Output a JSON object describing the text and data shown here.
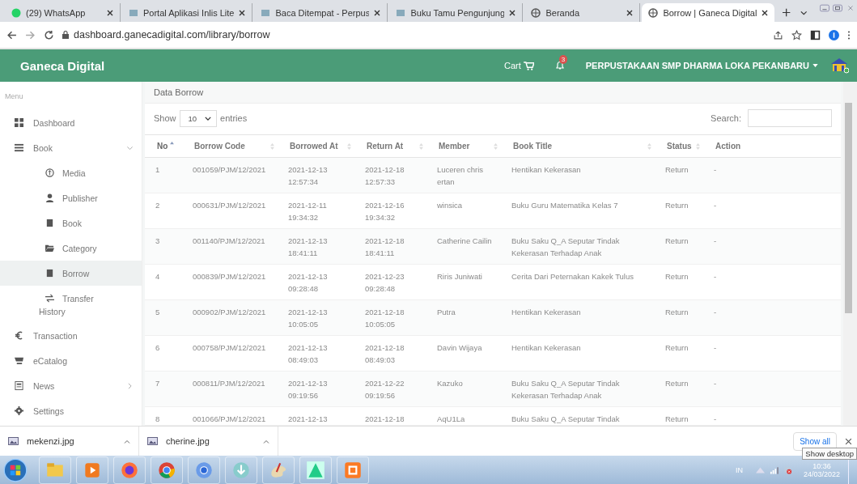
{
  "browser": {
    "tabs": [
      {
        "title": "(29) WhatsApp",
        "selected": false
      },
      {
        "title": "Portal Aplikasi Inlis Lite",
        "selected": false
      },
      {
        "title": "Baca Ditempat - Perpus",
        "selected": false
      },
      {
        "title": "Buku Tamu Pengunjung",
        "selected": false
      },
      {
        "title": "Beranda",
        "selected": false
      },
      {
        "title": "Borrow | Ganeca Digital",
        "selected": true
      }
    ],
    "address": "dashboard.ganecadigital.com/library/borrow"
  },
  "header": {
    "brand": "Ganeca Digital",
    "cart": "Cart",
    "notification_count": "3",
    "user": "PERPUSTAKAAN SMP DHARMA LOKA PEKANBARU"
  },
  "sidebar": {
    "heading": "Menu",
    "items": [
      {
        "label": "Dashboard",
        "selected": false
      },
      {
        "label": "Book",
        "selected": false,
        "expanded": true,
        "children": [
          {
            "label": "Media",
            "selected": false
          },
          {
            "label": "Publisher",
            "selected": false
          },
          {
            "label": "Book",
            "selected": false
          },
          {
            "label": "Category",
            "selected": false
          },
          {
            "label": "Borrow",
            "selected": true
          },
          {
            "label": "Transfer History",
            "selected": false
          }
        ]
      },
      {
        "label": "Transaction",
        "selected": false
      },
      {
        "label": "eCatalog",
        "selected": false
      },
      {
        "label": "News",
        "selected": false,
        "expanded": false
      },
      {
        "label": "Settings",
        "selected": false
      }
    ]
  },
  "panel": {
    "title": "Data Borrow",
    "show_label": "Show",
    "page_size": "10",
    "entries_label": "entries",
    "search_label": "Search:"
  },
  "table": {
    "columns": [
      {
        "label": "No",
        "sortable": true,
        "sorted_ascending": true
      },
      {
        "label": "Borrow Code",
        "sortable": true,
        "sorted_ascending": false
      },
      {
        "label": "Borrowed At",
        "sortable": true,
        "sorted_ascending": false
      },
      {
        "label": "Return At",
        "sortable": true,
        "sorted_ascending": false
      },
      {
        "label": "Member",
        "sortable": true,
        "sorted_ascending": false
      },
      {
        "label": "Book Title",
        "sortable": true,
        "sorted_ascending": false
      },
      {
        "label": "Status",
        "sortable": true,
        "sorted_ascending": false
      },
      {
        "label": "Action",
        "sortable": false,
        "sorted_ascending": false
      }
    ],
    "rows": [
      [
        "1",
        "001059/PJM/12/2021",
        "2021-12-13 12:57:34",
        "2021-12-18 12:57:33",
        "Luceren chris ertan",
        "Hentikan Kekerasan",
        "Return",
        "-"
      ],
      [
        "2",
        "000631/PJM/12/2021",
        "2021-12-11 19:34:32",
        "2021-12-16 19:34:32",
        "winsica",
        "Buku Guru Matematika Kelas 7",
        "Return",
        "-"
      ],
      [
        "3",
        "001140/PJM/12/2021",
        "2021-12-13 18:41:11",
        "2021-12-18 18:41:11",
        "Catherine Cailin",
        "Buku Saku Q_A Seputar Tindak Kekerasan Terhadap Anak",
        "Return",
        "-"
      ],
      [
        "4",
        "000839/PJM/12/2021",
        "2021-12-13 09:28:48",
        "2021-12-23 09:28:48",
        "Riris Juniwati",
        "Cerita Dari Peternakan Kakek Tulus",
        "Return",
        "-"
      ],
      [
        "5",
        "000902/PJM/12/2021",
        "2021-12-13 10:05:05",
        "2021-12-18 10:05:05",
        "Putra",
        "Hentikan Kekerasan",
        "Return",
        "-"
      ],
      [
        "6",
        "000758/PJM/12/2021",
        "2021-12-13 08:49:03",
        "2021-12-18 08:49:03",
        "Davin Wijaya",
        "Hentikan Kekerasan",
        "Return",
        "-"
      ],
      [
        "7",
        "000811/PJM/12/2021",
        "2021-12-13 09:19:56",
        "2021-12-22 09:19:56",
        "Kazuko",
        "Buku Saku Q_A Seputar Tindak Kekerasan Terhadap Anak",
        "Return",
        "-"
      ],
      [
        "8",
        "001066/PJM/12/2021",
        "2021-12-13",
        "2021-12-18",
        "AqU1La",
        "Buku Saku Q_A Seputar Tindak",
        "Return",
        "-"
      ]
    ]
  },
  "downloads": {
    "files": [
      "mekenzi.jpg",
      "cherine.jpg"
    ],
    "show_all": "Show all",
    "tooltip": "Show desktop"
  },
  "taskbar": {
    "language": "IN",
    "time": "10:36",
    "date": "24/03/2022"
  }
}
